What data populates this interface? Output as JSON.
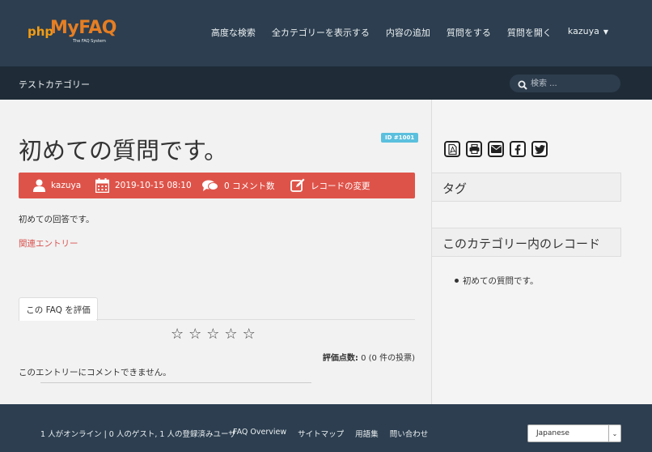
{
  "header": {
    "logo": {
      "brand_prefix": "php",
      "brand_name": "MyFAQ",
      "tagline": "The FAQ System"
    },
    "nav": [
      {
        "label": "高度な検索"
      },
      {
        "label": "全カテゴリーを表示する"
      },
      {
        "label": "内容の追加"
      },
      {
        "label": "質問をする"
      },
      {
        "label": "質問を開く"
      }
    ],
    "user": {
      "name": "kazuya"
    }
  },
  "subbar": {
    "category": "テストカテゴリー",
    "search_placeholder": "検索 ..."
  },
  "faq": {
    "title": "初めての質問です。",
    "id_badge": "ID #1001",
    "author": "kazuya",
    "date": "2019-10-15 08:10",
    "comments": "0 コメント数",
    "edit": "レコードの変更",
    "answer": "初めての回答です。",
    "related_link": "関連エントリー"
  },
  "rating": {
    "tab_label": "この FAQ を評価",
    "stars": [
      "☆",
      "☆",
      "☆",
      "☆",
      "☆"
    ],
    "summary_label": "評価点数:",
    "summary_value": " 0 (0 件の投票)",
    "rating_value": 0,
    "vote_count": 0
  },
  "comments_notice": "このエントリーにコメントできません。",
  "sidebar": {
    "share_icons": [
      "pdf-icon",
      "print-icon",
      "email-icon",
      "facebook-icon",
      "twitter-icon"
    ],
    "tags_title": "タグ",
    "records_title": "このカテゴリー内のレコード",
    "records": [
      "初めての質問です。"
    ]
  },
  "footer": {
    "online": "1 人がオンライン | 0 人のゲスト, 1 人の登録済みユーザ",
    "links": [
      "FAQ Overview",
      "サイトマップ",
      "用語集",
      "問い合わせ"
    ],
    "language": "Japanese"
  },
  "colors": {
    "navbar": "#2c3e50",
    "subbar": "#1f2c38",
    "meta_bar": "#de5349",
    "badge": "#5bc0de",
    "link": "#d9534f"
  }
}
